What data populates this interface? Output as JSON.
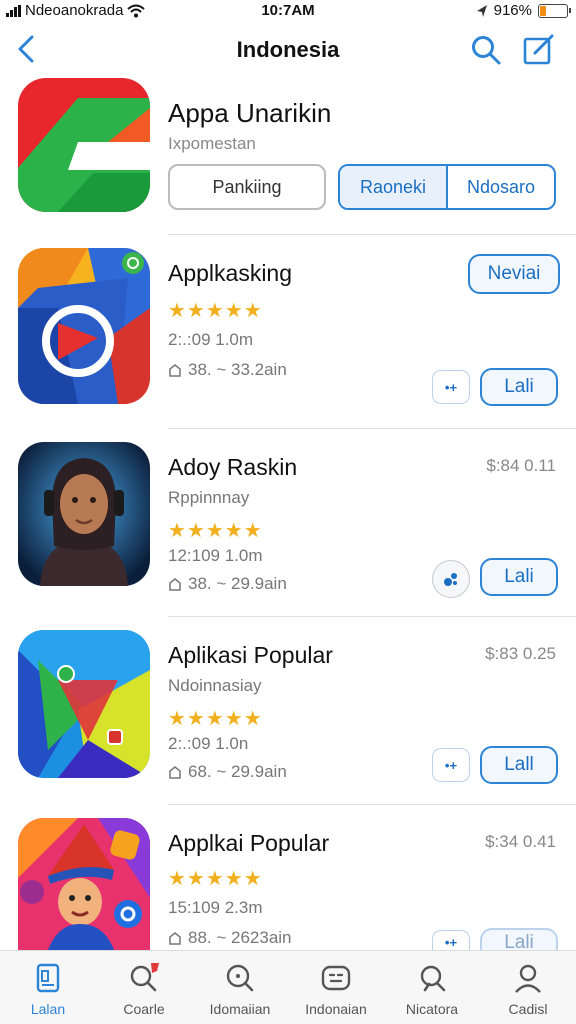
{
  "status_bar": {
    "carrier": "Ndeoanokrada",
    "time": "10:7AM",
    "battery": "916%",
    "battery_level": 0.2
  },
  "nav": {
    "title": "Indonesia",
    "icons": [
      "back-chevron-icon",
      "search-icon",
      "compose-icon"
    ]
  },
  "featured": {
    "name": "Appa Unarikin",
    "subtitle": "Ixpomestan",
    "button_left": "Pankiing",
    "segment": [
      "Raoneki",
      "Ndosaro"
    ]
  },
  "apps": [
    {
      "name": "Applkasking",
      "subtitle": "",
      "rating": 4.5,
      "stars": "★★★★★",
      "meta1": "2:.:09 1.0m",
      "meta2": "38. ~ 33.2ain",
      "price": "",
      "action": "Lali",
      "top_action": "Neviai",
      "side_button": "•+"
    },
    {
      "name": "Adoy Raskin",
      "subtitle": "Rppinnnay",
      "rating": 4.5,
      "stars": "★★★★★",
      "meta1": "12:109 1.0m",
      "meta2": "38. ~ 29.9ain",
      "price": "$:84 0.11",
      "action": "Lali",
      "side_button": "spinner"
    },
    {
      "name": "Aplikasi Popular",
      "subtitle": "Ndoinnasiay",
      "rating": 4.5,
      "stars": "★★★★★",
      "meta1": "2:.:09 1.0n",
      "meta2": "68. ~ 29.9ain",
      "price": "$:83 0.25",
      "action": "Lall",
      "side_button": "•+"
    },
    {
      "name": "Applkai Popular",
      "subtitle": "",
      "rating": 4.5,
      "stars": "★★★★★",
      "meta1": "15:109 2.3m",
      "meta2": "88. ~ 2623ain",
      "price": "$:34 0.41",
      "action": "Lali",
      "side_button": "•+"
    }
  ],
  "tabs": [
    {
      "label": "Lalan",
      "icon": "today-icon",
      "active": true
    },
    {
      "label": "Coarle",
      "icon": "search-badge-icon",
      "active": false
    },
    {
      "label": "Idomaiian",
      "icon": "explore-icon",
      "active": false
    },
    {
      "label": "Indonaian",
      "icon": "games-icon",
      "active": false
    },
    {
      "label": "Nicatora",
      "icon": "search-icon",
      "active": false
    },
    {
      "label": "Cadisl",
      "icon": "profile-icon",
      "active": false
    }
  ],
  "colors": {
    "accent": "#2c84d6",
    "star": "#f2b01e",
    "battery": "#f28c12"
  }
}
